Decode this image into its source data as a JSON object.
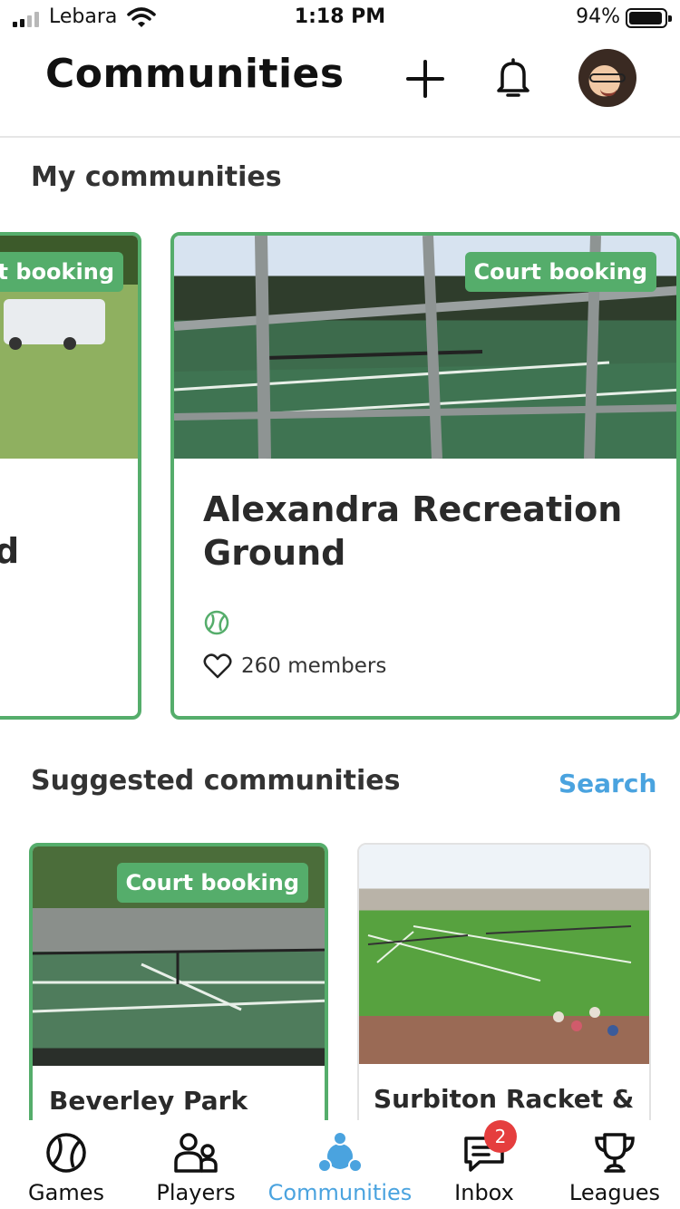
{
  "status_bar": {
    "carrier": "Lebara",
    "time": "1:18 PM",
    "battery_percent": "94%",
    "signal_bars": 2,
    "battery_level": 0.94
  },
  "header": {
    "title": "Communities",
    "add_icon": "plus-icon",
    "notifications_icon": "bell-icon"
  },
  "my_communities": {
    "heading": "My communities",
    "cards": [
      {
        "badge": "rt booking",
        "name": "d"
      },
      {
        "badge": "Court booking",
        "name": "Alexandra Recreation Ground",
        "sport_icon": "tennis-ball-icon",
        "members": "260 members"
      }
    ]
  },
  "suggested": {
    "heading": "Suggested communities",
    "search_label": "Search",
    "cards": [
      {
        "badge": "Court booking",
        "name": "Beverley Park"
      },
      {
        "badge": "",
        "name": "Surbiton Racket &"
      }
    ]
  },
  "tabbar": {
    "items": [
      {
        "label": "Games",
        "icon": "tennis-ball-icon"
      },
      {
        "label": "Players",
        "icon": "players-icon"
      },
      {
        "label": "Communities",
        "icon": "communities-icon"
      },
      {
        "label": "Inbox",
        "icon": "chat-icon",
        "badge": "2"
      },
      {
        "label": "Leagues",
        "icon": "trophy-icon"
      }
    ],
    "active": "Communities",
    "accent_color": "#4aa3df",
    "badge_color": "#e53e3e"
  },
  "colors": {
    "brand_green": "#55ad6b",
    "link_blue": "#4aa3df"
  }
}
